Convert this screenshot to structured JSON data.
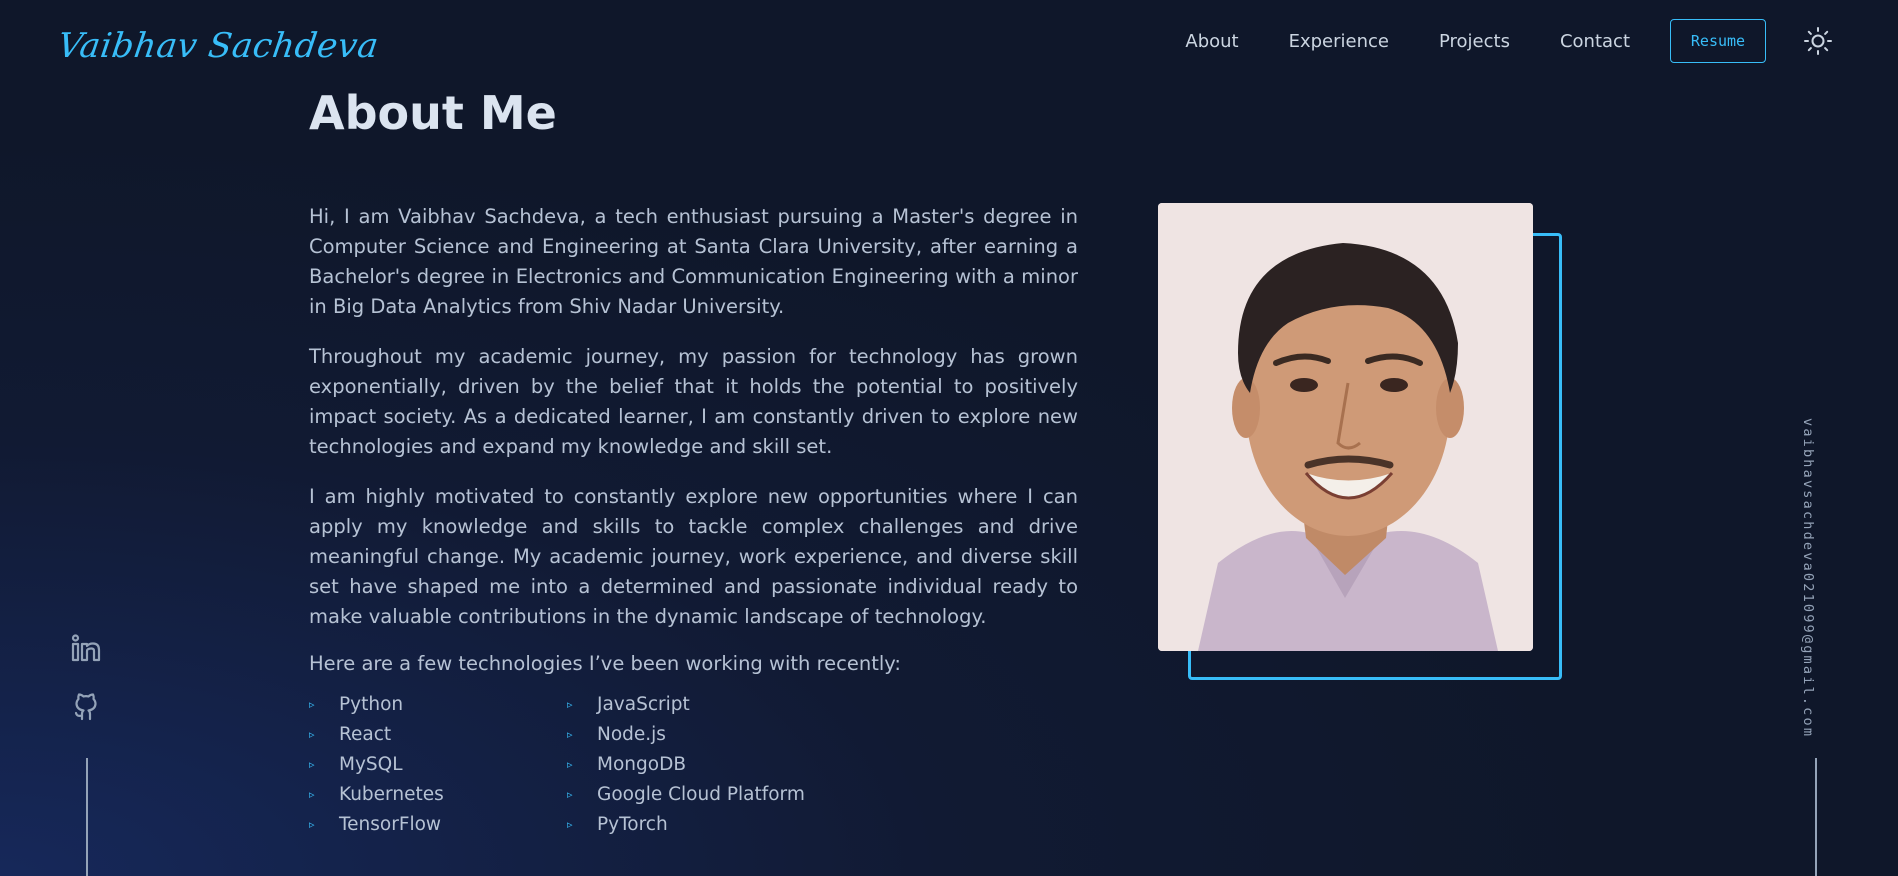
{
  "header": {
    "logo_text": "Vaibhav Sachdeva",
    "nav": [
      {
        "label": "About"
      },
      {
        "label": "Experience"
      },
      {
        "label": "Projects"
      },
      {
        "label": "Contact"
      }
    ],
    "resume_label": "Resume",
    "theme_toggle_icon": "sun-icon"
  },
  "about": {
    "title": "About Me",
    "paragraphs": [
      "Hi, I am Vaibhav Sachdeva, a tech enthusiast pursuing a Master's degree in Computer Science and Engineering at Santa Clara University, after earning a Bachelor's degree in Electronics and Communication Engineering with a minor in Big Data Analytics from Shiv Nadar University.",
      "Throughout my academic journey, my passion for technology has grown exponentially, driven by the belief that it holds the potential to positively impact society. As a dedicated learner, I am constantly driven to explore new technologies and expand my knowledge and skill set.",
      "I am highly motivated to constantly explore new opportunities where I can apply my knowledge and skills to tackle complex challenges and drive meaningful change. My academic journey, work experience, and diverse skill set have shaped me into a determined and passionate individual ready to make valuable contributions in the dynamic landscape of technology."
    ],
    "tech_intro": "Here are a few technologies I’ve been working with recently:",
    "technologies": [
      "Python",
      "JavaScript",
      "React",
      "Node.js",
      "MySQL",
      "MongoDB",
      "Kubernetes",
      "Google Cloud Platform",
      "TensorFlow",
      "PyTorch"
    ],
    "bullet": "▹"
  },
  "sidebar": {
    "social_icons": [
      "linkedin-icon",
      "github-icon"
    ],
    "email": "vaibhavsachdeva021099@gmail.com"
  },
  "colors": {
    "accent": "#38bdf8",
    "background": "#0f172a",
    "text": "#cbd5e1"
  }
}
